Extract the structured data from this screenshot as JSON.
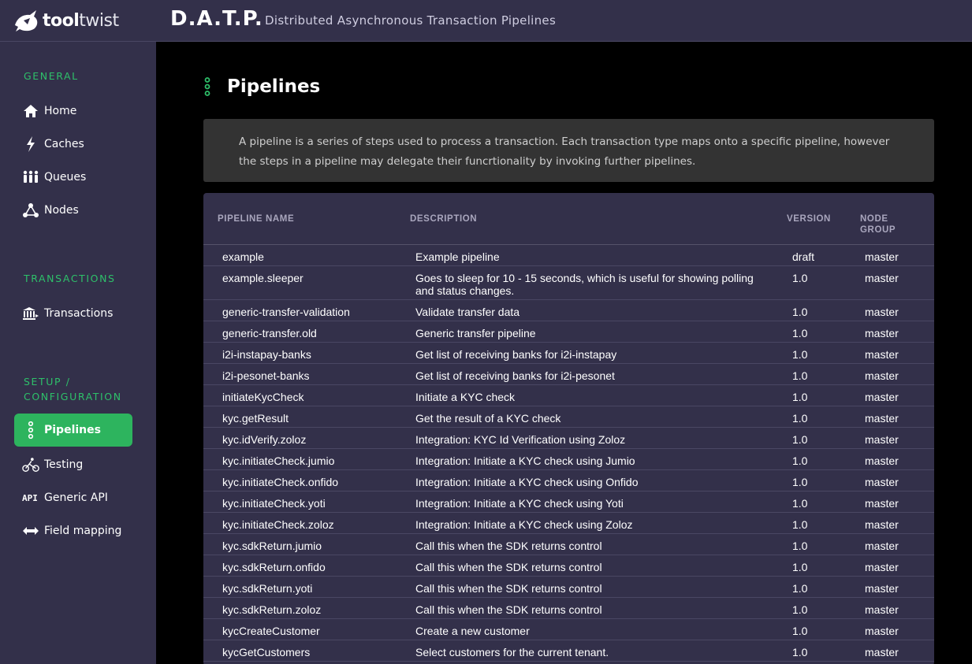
{
  "header": {
    "logo_bold": "tool",
    "logo_light": "twist",
    "app_title": "D.A.T.P.",
    "app_subtitle": "Distributed Asynchronous Transaction Pipelines"
  },
  "sidebar": {
    "sections": [
      {
        "title": "GENERAL",
        "items": [
          {
            "label": "Home",
            "icon": "home-icon"
          },
          {
            "label": "Caches",
            "icon": "lightning-icon"
          },
          {
            "label": "Queues",
            "icon": "people-queue-icon"
          },
          {
            "label": "Nodes",
            "icon": "nodes-icon"
          }
        ]
      },
      {
        "title": "TRANSACTIONS",
        "items": [
          {
            "label": "Transactions",
            "icon": "bank-icon"
          }
        ]
      },
      {
        "title": "SETUP /",
        "title2": "CONFIGURATION",
        "items": [
          {
            "label": "Pipelines",
            "icon": "pipeline-icon",
            "active": true
          },
          {
            "label": "Testing",
            "icon": "cyclist-icon"
          },
          {
            "label": "Generic API",
            "icon": "api-icon"
          },
          {
            "label": "Field mapping",
            "icon": "arrows-horizontal-icon"
          }
        ]
      }
    ]
  },
  "main": {
    "title": "Pipelines",
    "description": "A pipeline is a series of steps used to process a transaction. Each transaction type maps onto a specific pipeline, however the steps in a pipeline may delegate their funcrtionality by invoking further pipelines.",
    "table": {
      "headers": [
        "PIPELINE NAME",
        "DESCRIPTION",
        "VERSION",
        "NODE",
        "GROUP"
      ],
      "rows": [
        [
          "example",
          "Example pipeline",
          "draft",
          "master"
        ],
        [
          "example.sleeper",
          "Goes to sleep for 10 - 15 seconds, which is useful for showing polling and status changes.",
          "1.0",
          "master"
        ],
        [
          "generic-transfer-validation",
          "Validate transfer data",
          "1.0",
          "master"
        ],
        [
          "generic-transfer.old",
          "Generic transfer pipeline",
          "1.0",
          "master"
        ],
        [
          "i2i-instapay-banks",
          "Get list of receiving banks for i2i-instapay",
          "1.0",
          "master"
        ],
        [
          "i2i-pesonet-banks",
          "Get list of receiving banks for i2i-pesonet",
          "1.0",
          "master"
        ],
        [
          "initiateKycCheck",
          "Initiate a KYC check",
          "1.0",
          "master"
        ],
        [
          "kyc.getResult",
          "Get the result of a KYC check",
          "1.0",
          "master"
        ],
        [
          "kyc.idVerify.zoloz",
          "Integration: KYC Id Verification using Zoloz",
          "1.0",
          "master"
        ],
        [
          "kyc.initiateCheck.jumio",
          "Integration: Initiate a KYC check using Jumio",
          "1.0",
          "master"
        ],
        [
          "kyc.initiateCheck.onfido",
          "Integration: Initiate a KYC check using Onfido",
          "1.0",
          "master"
        ],
        [
          "kyc.initiateCheck.yoti",
          "Integration: Initiate a KYC check using Yoti",
          "1.0",
          "master"
        ],
        [
          "kyc.initiateCheck.zoloz",
          "Integration: Initiate a KYC check using Zoloz",
          "1.0",
          "master"
        ],
        [
          "kyc.sdkReturn.jumio",
          "Call this when the SDK returns control",
          "1.0",
          "master"
        ],
        [
          "kyc.sdkReturn.onfido",
          "Call this when the SDK returns control",
          "1.0",
          "master"
        ],
        [
          "kyc.sdkReturn.yoti",
          "Call this when the SDK returns control",
          "1.0",
          "master"
        ],
        [
          "kyc.sdkReturn.zoloz",
          "Call this when the SDK returns control",
          "1.0",
          "master"
        ],
        [
          "kycCreateCustomer",
          "Create a new customer",
          "1.0",
          "master"
        ],
        [
          "kycGetCustomers",
          "Select customers for the current tenant.",
          "1.0",
          "master"
        ]
      ]
    }
  },
  "colors": {
    "accent_green": "#2db45e",
    "sidebar_bg": "#33304a",
    "section_green": "#2ec06a"
  }
}
